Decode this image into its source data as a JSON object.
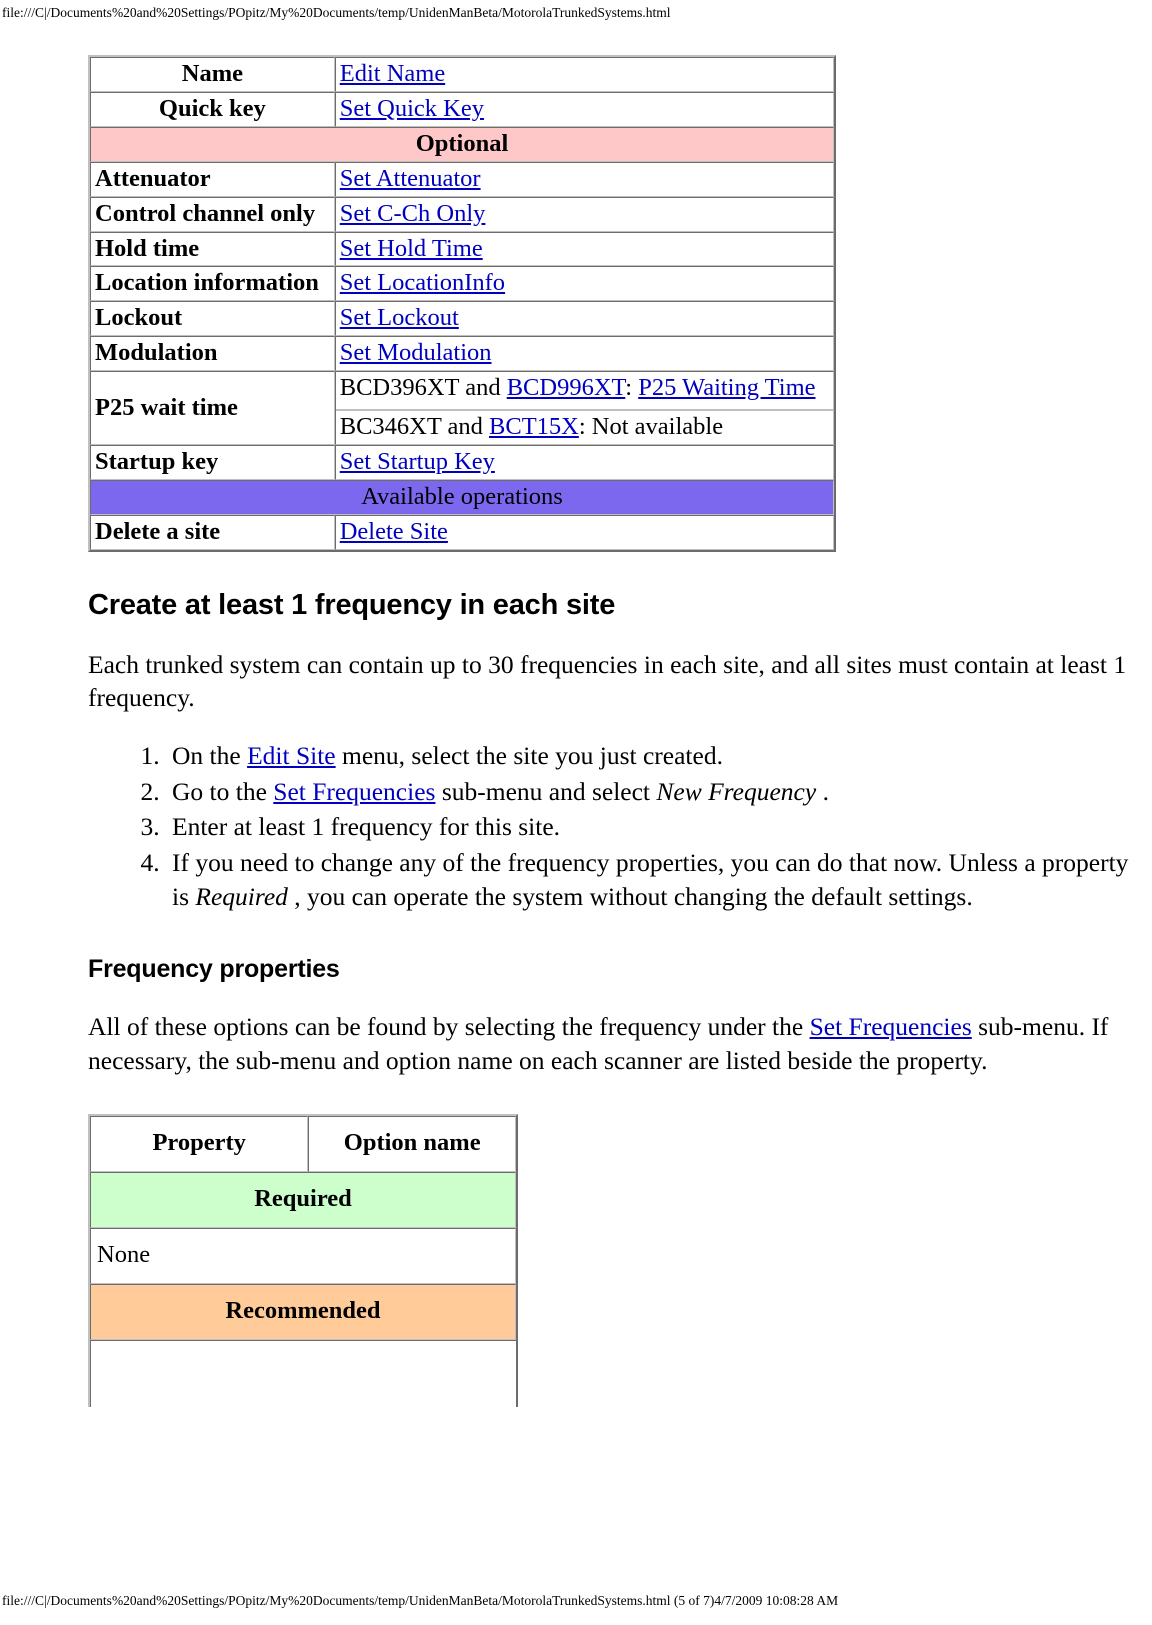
{
  "page": {
    "header_url": "file:///C|/Documents%20and%20Settings/POpitz/My%20Documents/temp/UnidenManBeta/MotorolaTrunkedSystems.html",
    "footer_url": "file:///C|/Documents%20and%20Settings/POpitz/My%20Documents/temp/UnidenManBeta/MotorolaTrunkedSystems.html (5 of 7)4/7/2009 10:08:28 AM"
  },
  "colors": {
    "optional_band": "#FFC8C8",
    "operations_band": "#7B68EE",
    "required_band": "#CCFFCC",
    "recommended_band": "#FFCC99",
    "link": "#0000C0",
    "table_border": "#C0C0C0"
  },
  "site_table": {
    "rows": [
      {
        "type": "pair",
        "name": "Name",
        "centered": true,
        "link": "Edit Name"
      },
      {
        "type": "pair",
        "name": "Quick key",
        "centered": true,
        "link": "Set Quick Key"
      },
      {
        "type": "band",
        "style": "optional",
        "label": "Optional"
      },
      {
        "type": "pair",
        "name": "Attenuator",
        "centered": false,
        "link": "Set Attenuator"
      },
      {
        "type": "pair",
        "name": "Control channel only",
        "centered": false,
        "link": "Set C-Ch Only"
      },
      {
        "type": "pair",
        "name": "Hold time",
        "centered": false,
        "link": "Set Hold Time"
      },
      {
        "type": "pair",
        "name": "Location information",
        "centered": false,
        "link": "Set LocationInfo"
      },
      {
        "type": "pair",
        "name": "Lockout",
        "centered": false,
        "link": "Set Lockout"
      },
      {
        "type": "pair",
        "name": "Modulation",
        "centered": false,
        "link": "Set Modulation"
      },
      {
        "type": "nested",
        "name": "P25 wait time"
      },
      {
        "type": "pair",
        "name": "Startup key",
        "centered": false,
        "link": "Set Startup Key"
      },
      {
        "type": "band",
        "style": "operations",
        "label": "Available operations"
      },
      {
        "type": "pair",
        "name": "Delete a site",
        "centered": false,
        "link": "Delete Site"
      }
    ],
    "p25": {
      "line1_pre": "BCD396XT and ",
      "line1_link1": "BCD996XT",
      "line1_mid": ": ",
      "line1_link2": "P25 Waiting Time",
      "line2_pre": "BC346XT and ",
      "line2_link": "BCT15X",
      "line2_post": ": Not available"
    }
  },
  "section_frequency": {
    "heading": "Create at least 1 frequency in each site",
    "intro": "Each trunked system can contain up to 30 frequencies in each site, and all sites must contain at least 1 frequency.",
    "steps": [
      {
        "pre": "On the ",
        "link": "Edit Site",
        "post": " menu, select the site you just created."
      },
      {
        "pre": "Go to the ",
        "link": "Set Frequencies",
        "post": " sub-menu and select ",
        "italic": "New Frequency",
        "tail": " ."
      },
      {
        "pre": "Enter at least 1 frequency for this site."
      },
      {
        "pre": "If you need to change any of the frequency properties, you can do that now. Unless a property is ",
        "italic": "Required",
        "tail": " , you can operate the system without changing the default settings."
      }
    ]
  },
  "section_properties": {
    "heading": "Frequency properties",
    "intro_pre": "All of these options can be found by selecting the frequency under the ",
    "intro_link": "Set Frequencies",
    "intro_post": " sub-menu. If necessary, the sub-menu and option name on each scanner are listed beside the property."
  },
  "freq_table": {
    "header": {
      "property": "Property",
      "option_name": "Option name"
    },
    "rows": [
      {
        "type": "band",
        "style": "required",
        "label": "Required"
      },
      {
        "type": "plain",
        "label": "None"
      },
      {
        "type": "band",
        "style": "recommended",
        "label": "Recommended"
      },
      {
        "type": "empty",
        "label": ""
      }
    ]
  }
}
